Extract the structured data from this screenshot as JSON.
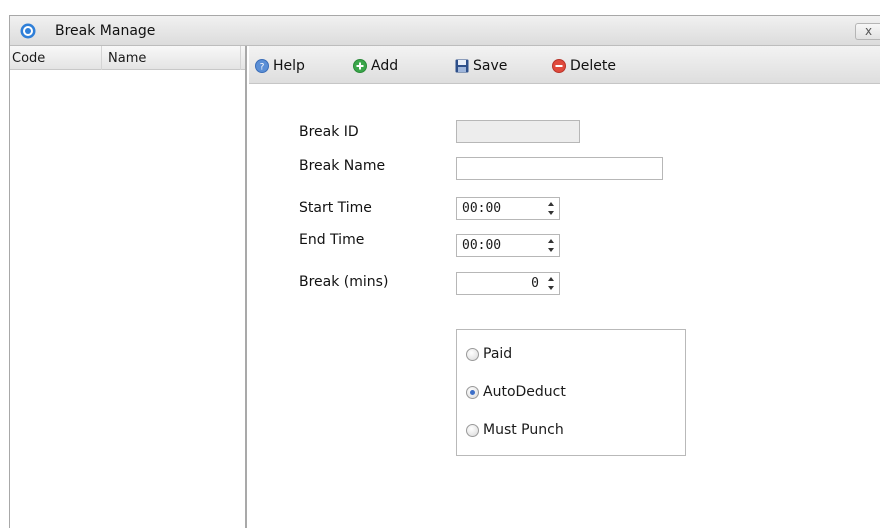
{
  "window": {
    "title": "Break Manage",
    "close_label": "x"
  },
  "list": {
    "columns": [
      "Code",
      "Name"
    ]
  },
  "toolbar": {
    "help": "Help",
    "add": "Add",
    "save": "Save",
    "delete": "Delete"
  },
  "form": {
    "break_id": {
      "label": "Break ID",
      "value": ""
    },
    "break_name": {
      "label": "Break Name",
      "value": ""
    },
    "start_time": {
      "label": "Start Time",
      "value": "00:00"
    },
    "end_time": {
      "label": "End Time",
      "value": "00:00"
    },
    "break_mins": {
      "label": "Break (mins)",
      "value": "0"
    }
  },
  "pay_type": {
    "options": [
      "Paid",
      "AutoDeduct",
      "Must Punch"
    ],
    "selected": "AutoDeduct"
  },
  "colors": {
    "accent": "#3d6fc8",
    "add_green": "#3aa64a",
    "delete_red": "#e04a3c"
  },
  "icons": {
    "title": "clock-icon",
    "help": "help-icon",
    "add": "add-icon",
    "save": "save-icon",
    "delete": "delete-icon"
  }
}
